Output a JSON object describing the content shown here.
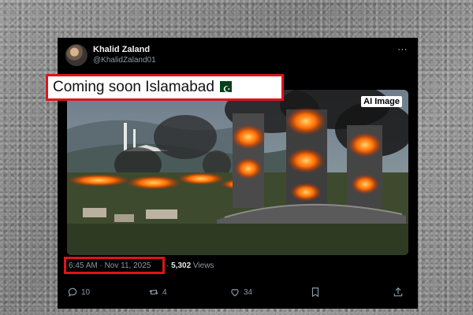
{
  "post": {
    "author_name": "Khalid Zaland",
    "author_handle": "@KhalidZaland01",
    "more_icon": "⋯",
    "text": "Coming soon Islamabad",
    "flag_icon": "pakistan-flag",
    "media_badge": "AI Image",
    "timestamp": "6:45 AM · Nov 11, 2025",
    "separator": " · ",
    "views_count": "5,302",
    "views_label": " Views"
  },
  "actions": {
    "replies": "10",
    "reposts": "4",
    "likes": "34"
  },
  "colors": {
    "highlight_border": "#e0131b",
    "background": "#000000",
    "muted_text": "#8b98a5",
    "fire": "#ff6a00"
  }
}
